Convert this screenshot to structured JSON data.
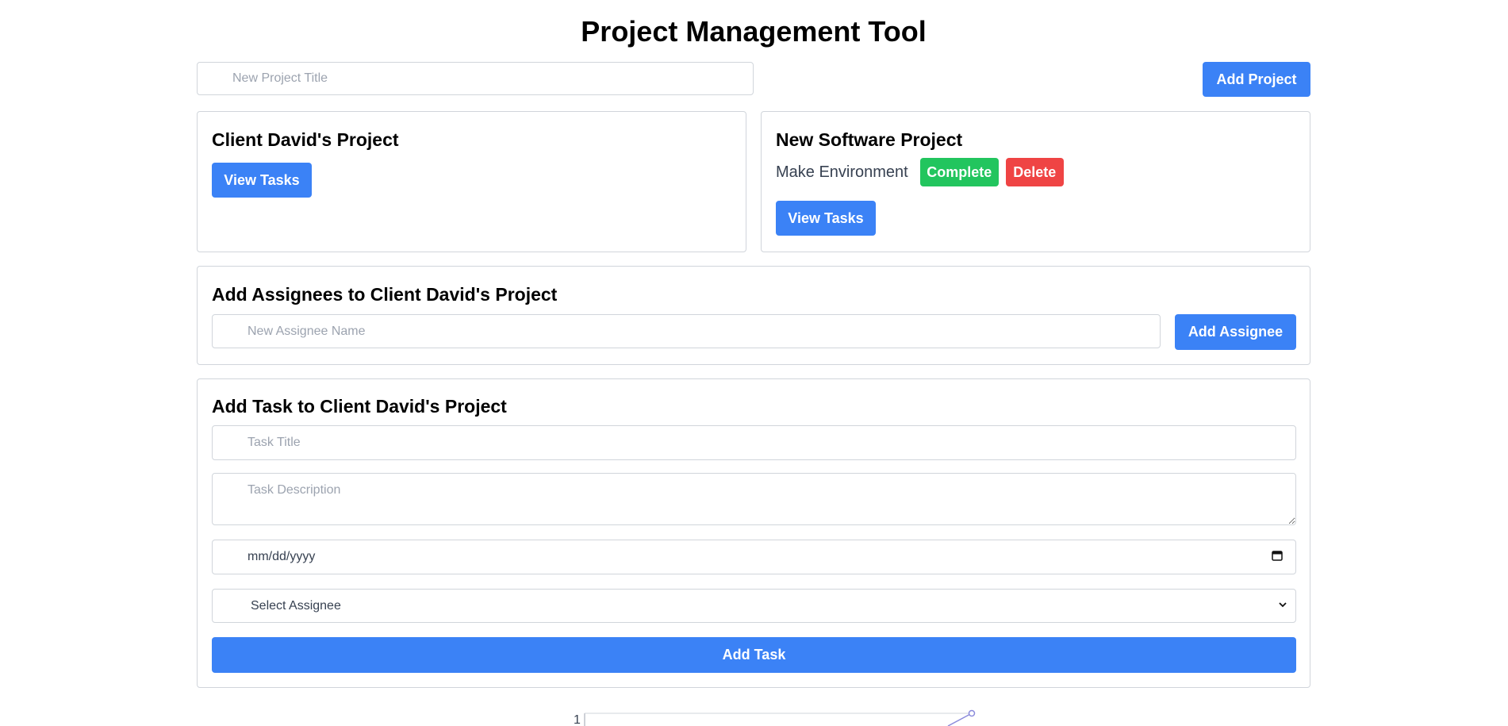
{
  "header": {
    "title": "Project Management Tool"
  },
  "new_project": {
    "placeholder": "New Project Title",
    "add_label": "Add Project"
  },
  "projects": [
    {
      "title": "Client David's Project",
      "view_label": "View Tasks",
      "tasks": []
    },
    {
      "title": "New Software Project",
      "view_label": "View Tasks",
      "tasks": [
        {
          "name": "Make Environment",
          "complete_label": "Complete",
          "delete_label": "Delete"
        }
      ]
    }
  ],
  "assignees": {
    "title": "Add Assignees to Client David's Project",
    "placeholder": "New Assignee Name",
    "add_label": "Add Assignee"
  },
  "task_form": {
    "title": "Add Task to Client David's Project",
    "title_placeholder": "Task Title",
    "description_placeholder": "Task Description",
    "date_placeholder": "mm/dd/yyyy",
    "assignee_select": "Select Assignee",
    "submit_label": "Add Task"
  },
  "chart_peek": {
    "y_tick_label": "1"
  },
  "colors": {
    "primary": "#3b82f6",
    "success": "#22c55e",
    "danger": "#ef4444",
    "border": "#d1d5db"
  }
}
